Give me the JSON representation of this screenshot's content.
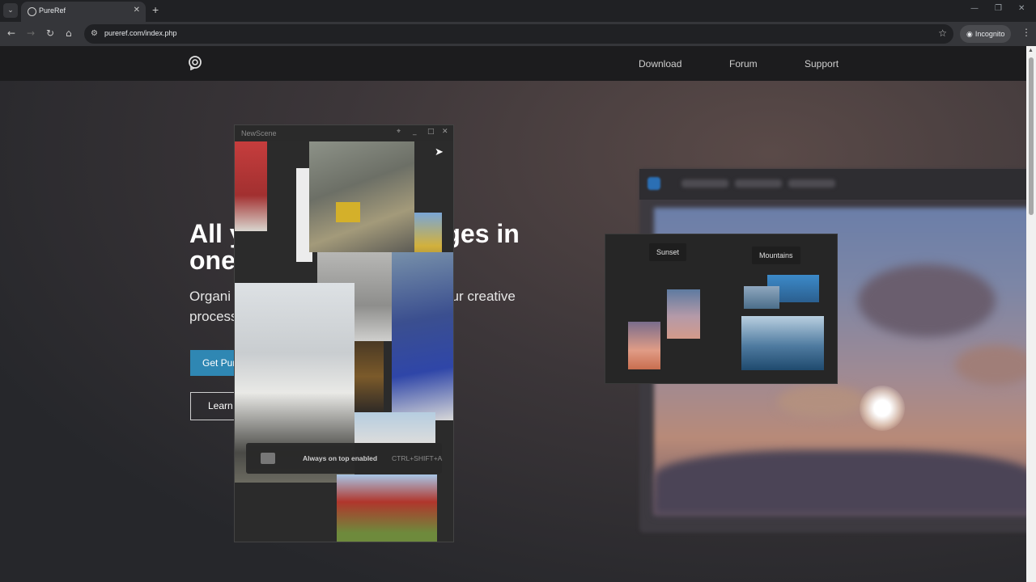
{
  "browser": {
    "tab_search_icon": "chevron-down-icon",
    "tab_title": "PureRef",
    "tab_close": "✕",
    "new_tab": "+",
    "url": "pureref.com/index.php",
    "incognito_label": "Incognito",
    "window_controls": [
      "—",
      "❐",
      "✕"
    ]
  },
  "site": {
    "nav": [
      "Download",
      "Forum",
      "Support"
    ]
  },
  "hero": {
    "title": "All your images in one",
    "title_line1_left": "All y",
    "title_line1_right": "ages in",
    "title_line2": "one",
    "subtitle_left1": "Organi",
    "subtitle_right1": "our creative",
    "subtitle_left2": "process",
    "primary_button": "Get Pur",
    "secondary_button": "Learn"
  },
  "demo_panel": {
    "label_sunset": "Sunset",
    "label_mountains": "Mountains"
  },
  "app_window": {
    "title": "NewScene",
    "toast_text": "Always on top enabled",
    "toast_shortcut": "CTRL+SHIFT+A"
  },
  "colors": {
    "accent": "#2f87b3",
    "browser_bg": "#202124",
    "toolbar_bg": "#35363a"
  }
}
